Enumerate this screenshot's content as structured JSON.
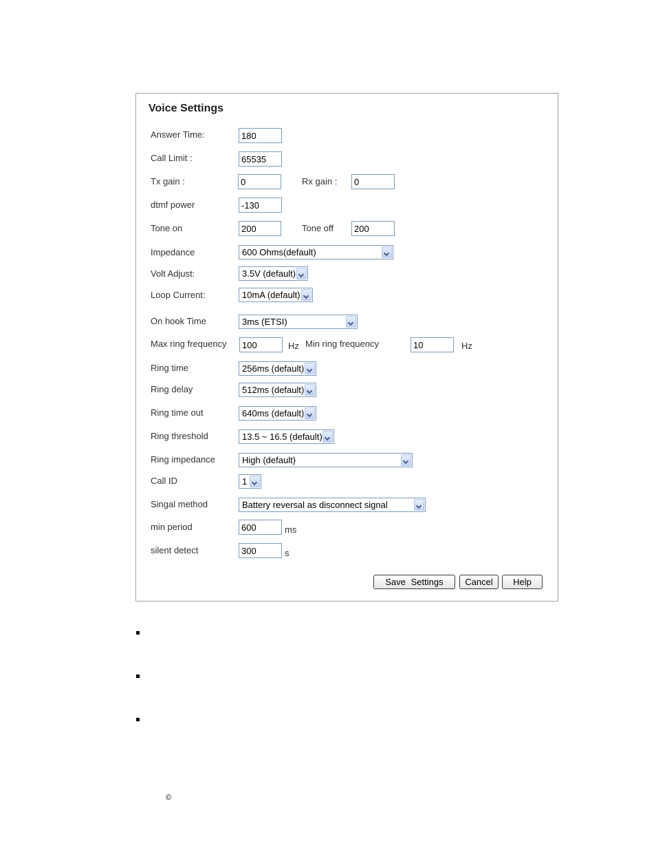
{
  "panel": {
    "title": "Voice Settings"
  },
  "fields": {
    "answer_time": {
      "label": "Answer Time:",
      "value": "180"
    },
    "call_limit": {
      "label": "Call Limit :",
      "value": "65535"
    },
    "tx_gain": {
      "label": "Tx gain :",
      "value": "0"
    },
    "rx_gain": {
      "label": "Rx gain :",
      "value": "0"
    },
    "dtmf_power": {
      "label": "dtmf power",
      "value": "-130"
    },
    "tone_on": {
      "label": "Tone on",
      "value": "200"
    },
    "tone_off": {
      "label": "Tone off",
      "value": "200"
    },
    "impedance": {
      "label": "Impedance",
      "value": "600 Ohms(default)"
    },
    "volt_adjust": {
      "label": "Volt Adjust:",
      "value": "3.5V (default)"
    },
    "loop_current": {
      "label": "Loop Current:",
      "value": "10mA (default)"
    },
    "on_hook_time": {
      "label": "On hook Time",
      "value": "3ms (ETSI)"
    },
    "max_ring_frequency": {
      "label": "Max ring frequency",
      "value": "100",
      "unit": "Hz"
    },
    "min_ring_frequency": {
      "label": "Min ring frequency",
      "value": "10",
      "unit": "Hz"
    },
    "ring_time": {
      "label": "Ring time",
      "value": "256ms (default)"
    },
    "ring_delay": {
      "label": "Ring delay",
      "value": "512ms (default)"
    },
    "ring_time_out": {
      "label": "Ring time out",
      "value": "640ms (default)"
    },
    "ring_threshold": {
      "label": "Ring threshold",
      "value": "13.5 ~ 16.5 (default)"
    },
    "ring_impedance": {
      "label": "Ring impedance",
      "value": "High (default)"
    },
    "call_id": {
      "label": "Call ID",
      "value": "1"
    },
    "signal_method": {
      "label": "Singal method",
      "value": "Battery reversal as disconnect signal"
    },
    "min_period": {
      "label": "min period",
      "value": "600",
      "unit": "ms"
    },
    "silent_detect": {
      "label": "silent detect",
      "value": "300",
      "unit": "s"
    }
  },
  "buttons": {
    "save": "Save Settings",
    "cancel": "Cancel",
    "help": "Help"
  },
  "footer": {
    "copyright": "©"
  }
}
